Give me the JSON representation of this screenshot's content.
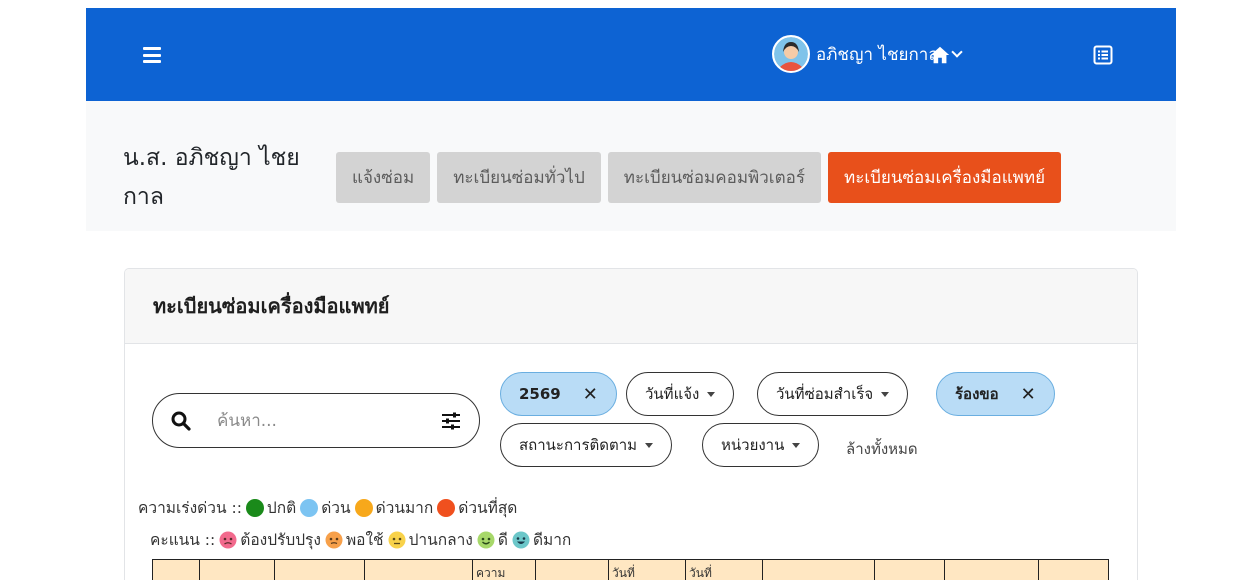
{
  "navbar": {
    "user_name": "อภิชญา ไชยกาล"
  },
  "userbar": {
    "full_name": "น.ส. อภิชญา ไชยกาล",
    "tabs": [
      {
        "label": "แจ้งซ่อม",
        "active": false
      },
      {
        "label": "ทะเบียนซ่อมทั่วไป",
        "active": false
      },
      {
        "label": "ทะเบียนซ่อมคอมพิวเตอร์",
        "active": false
      },
      {
        "label": "ทะเบียนซ่อมเครื่องมือแพทย์",
        "active": true
      }
    ]
  },
  "card": {
    "title": "ทะเบียนซ่อมเครื่องมือแพทย์",
    "search_placeholder": "ค้นหา...",
    "filters": {
      "year": "2569",
      "report_date": "วันที่แจ้ง",
      "done_date": "วันที่ซ่อมสำเร็จ",
      "status": "ร้องขอ",
      "tracking": "สถานะการติดตาม",
      "unit": "หน่วยงาน",
      "clear_all": "ล้างทั้งหมด"
    },
    "urgency_legend": {
      "label": "ความเร่งด่วน ::",
      "items": [
        {
          "label": "ปกติ",
          "color": "#1a8a1a"
        },
        {
          "label": "ด่วน",
          "color": "#7cc4f2"
        },
        {
          "label": "ด่วนมาก",
          "color": "#f7a81b"
        },
        {
          "label": "ด่วนที่สุด",
          "color": "#f0501e"
        }
      ]
    },
    "rating_legend": {
      "label": "คะแนน ::",
      "items": [
        {
          "label": "ต้องปรับปรุง",
          "color": "#f26a8d"
        },
        {
          "label": "พอใช้",
          "color": "#f7a04a"
        },
        {
          "label": "ปานกลาง",
          "color": "#f8d24a"
        },
        {
          "label": "ดี",
          "color": "#a7d86a"
        },
        {
          "label": "ดีมาก",
          "color": "#6cc7c9"
        }
      ]
    },
    "table_headers": [
      "",
      "",
      "",
      "",
      "ความ",
      "",
      "วันที่",
      "วันที่",
      "",
      "",
      "",
      ""
    ]
  }
}
